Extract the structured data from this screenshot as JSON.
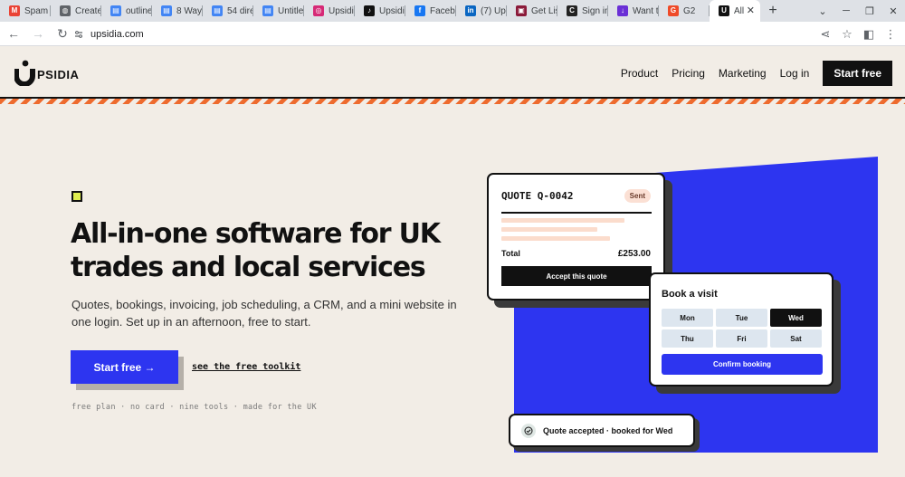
{
  "browser": {
    "tabs": [
      {
        "label": "Spam",
        "icon": "gmail-icon",
        "color": "#ea4335",
        "glyph": "M"
      },
      {
        "label": "Create",
        "icon": "globe-icon",
        "color": "#5f6368",
        "glyph": "◍"
      },
      {
        "label": "outline",
        "icon": "docs-icon",
        "color": "#4285f4",
        "glyph": "▤"
      },
      {
        "label": "8 Way",
        "icon": "docs-icon",
        "color": "#4285f4",
        "glyph": "▤"
      },
      {
        "label": "54 dire",
        "icon": "docs-icon",
        "color": "#4285f4",
        "glyph": "▤"
      },
      {
        "label": "Untitle",
        "icon": "docs-icon",
        "color": "#4285f4",
        "glyph": "▤"
      },
      {
        "label": "Upsidi",
        "icon": "instagram-icon",
        "color": "#d62976",
        "glyph": "◎"
      },
      {
        "label": "Upsidi",
        "icon": "tiktok-icon",
        "color": "#111111",
        "glyph": "♪"
      },
      {
        "label": "Faceb",
        "icon": "facebook-icon",
        "color": "#1877f2",
        "glyph": "f"
      },
      {
        "label": "(7) Up",
        "icon": "linkedin-icon",
        "color": "#0a66c2",
        "glyph": "in"
      },
      {
        "label": "Get Lis",
        "icon": "list-icon",
        "color": "#8b1a3a",
        "glyph": "▣"
      },
      {
        "label": "Sign in",
        "icon": "c-icon",
        "color": "#222222",
        "glyph": "C"
      },
      {
        "label": "Want t",
        "icon": "download-icon",
        "color": "#6a2fd6",
        "glyph": "↓"
      },
      {
        "label": "G2",
        "icon": "g2-icon",
        "color": "#ef4a28",
        "glyph": "G"
      },
      {
        "label": "All",
        "icon": "upsidia-icon",
        "color": "#111111",
        "glyph": "U",
        "active": true
      }
    ],
    "new_tab": "+",
    "url": "upsidia.com"
  },
  "site": {
    "logo_text": "PSIDIA",
    "nav": {
      "product": "Product",
      "pricing": "Pricing",
      "marketing": "Marketing",
      "login": "Log in",
      "cta": "Start free"
    }
  },
  "hero": {
    "title": "All-in-one software for UK trades and local services",
    "subtitle": "Quotes, bookings, invoicing, job scheduling, a CRM, and a mini website in one login. Set up in an afternoon, free to start.",
    "cta": "Start free →",
    "secondary_link": "see the free toolkit",
    "footnote": "free plan · no card · nine tools · made for the UK"
  },
  "quote_card": {
    "title": "QUOTE Q-0042",
    "badge": "Sent",
    "total_label": "Total",
    "total_value": "£253.00",
    "accept": "Accept this quote"
  },
  "booking_card": {
    "title": "Book a visit",
    "days": [
      "Mon",
      "Tue",
      "Wed",
      "Thu",
      "Fri",
      "Sat"
    ],
    "selected": "Wed",
    "confirm": "Confirm booking"
  },
  "toast": {
    "text": "Quote accepted · booked for Wed"
  }
}
